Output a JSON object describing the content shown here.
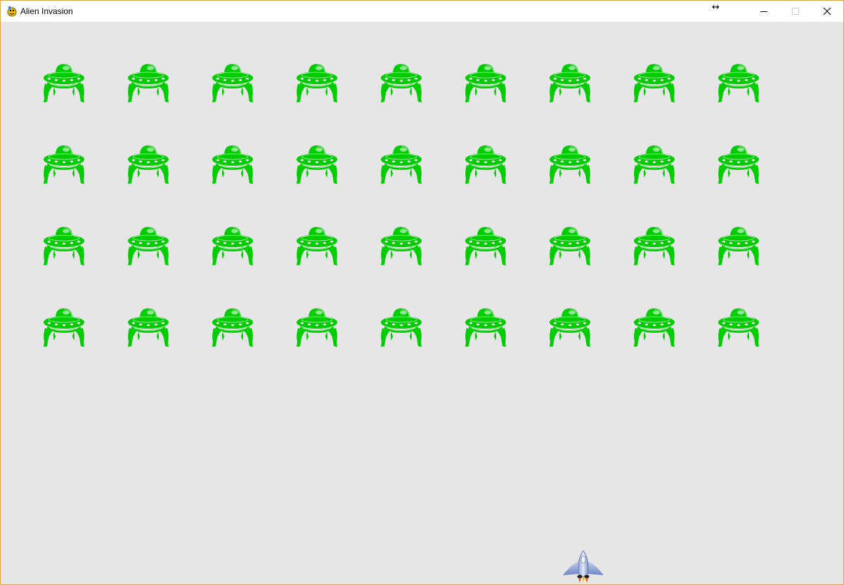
{
  "window": {
    "title": "Alien Invasion",
    "cursor_glyph": "↔",
    "controls": {
      "minimize_icon": "minimize-icon",
      "maximize_icon": "maximize-icon",
      "close_icon": "close-icon"
    }
  },
  "game": {
    "background_color": "#e6e6e6",
    "alien_color": "#00cc00",
    "alien_rows": 4,
    "alien_columns": 9,
    "ship_icon": "rocket-ship-icon"
  }
}
